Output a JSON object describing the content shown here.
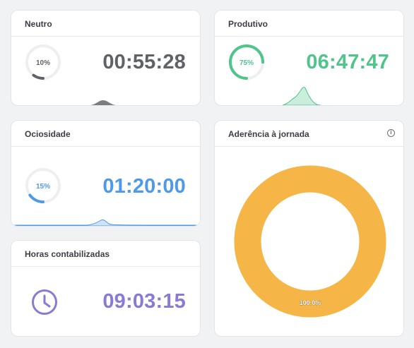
{
  "colors": {
    "neutral": "#5f6368",
    "productive": "#4fc48b",
    "idle": "#4f9ae8",
    "hours": "#8a7ad6",
    "adherence": "#f5b547"
  },
  "cards": {
    "neutral": {
      "title": "Neutro",
      "percent_label": "10%",
      "percent": 10,
      "time": "00:55:28"
    },
    "productive": {
      "title": "Produtivo",
      "percent_label": "75%",
      "percent": 75,
      "time": "06:47:47"
    },
    "idle": {
      "title": "Ociosidade",
      "percent_label": "15%",
      "percent": 15,
      "time": "01:20:00"
    },
    "hours": {
      "title": "Horas contabilizadas",
      "icon": "clock-icon",
      "time": "09:03:15"
    },
    "adherence": {
      "title": "Aderência à jornada",
      "info_icon": "info-icon",
      "value_label": "100.0%",
      "value": 100
    }
  }
}
